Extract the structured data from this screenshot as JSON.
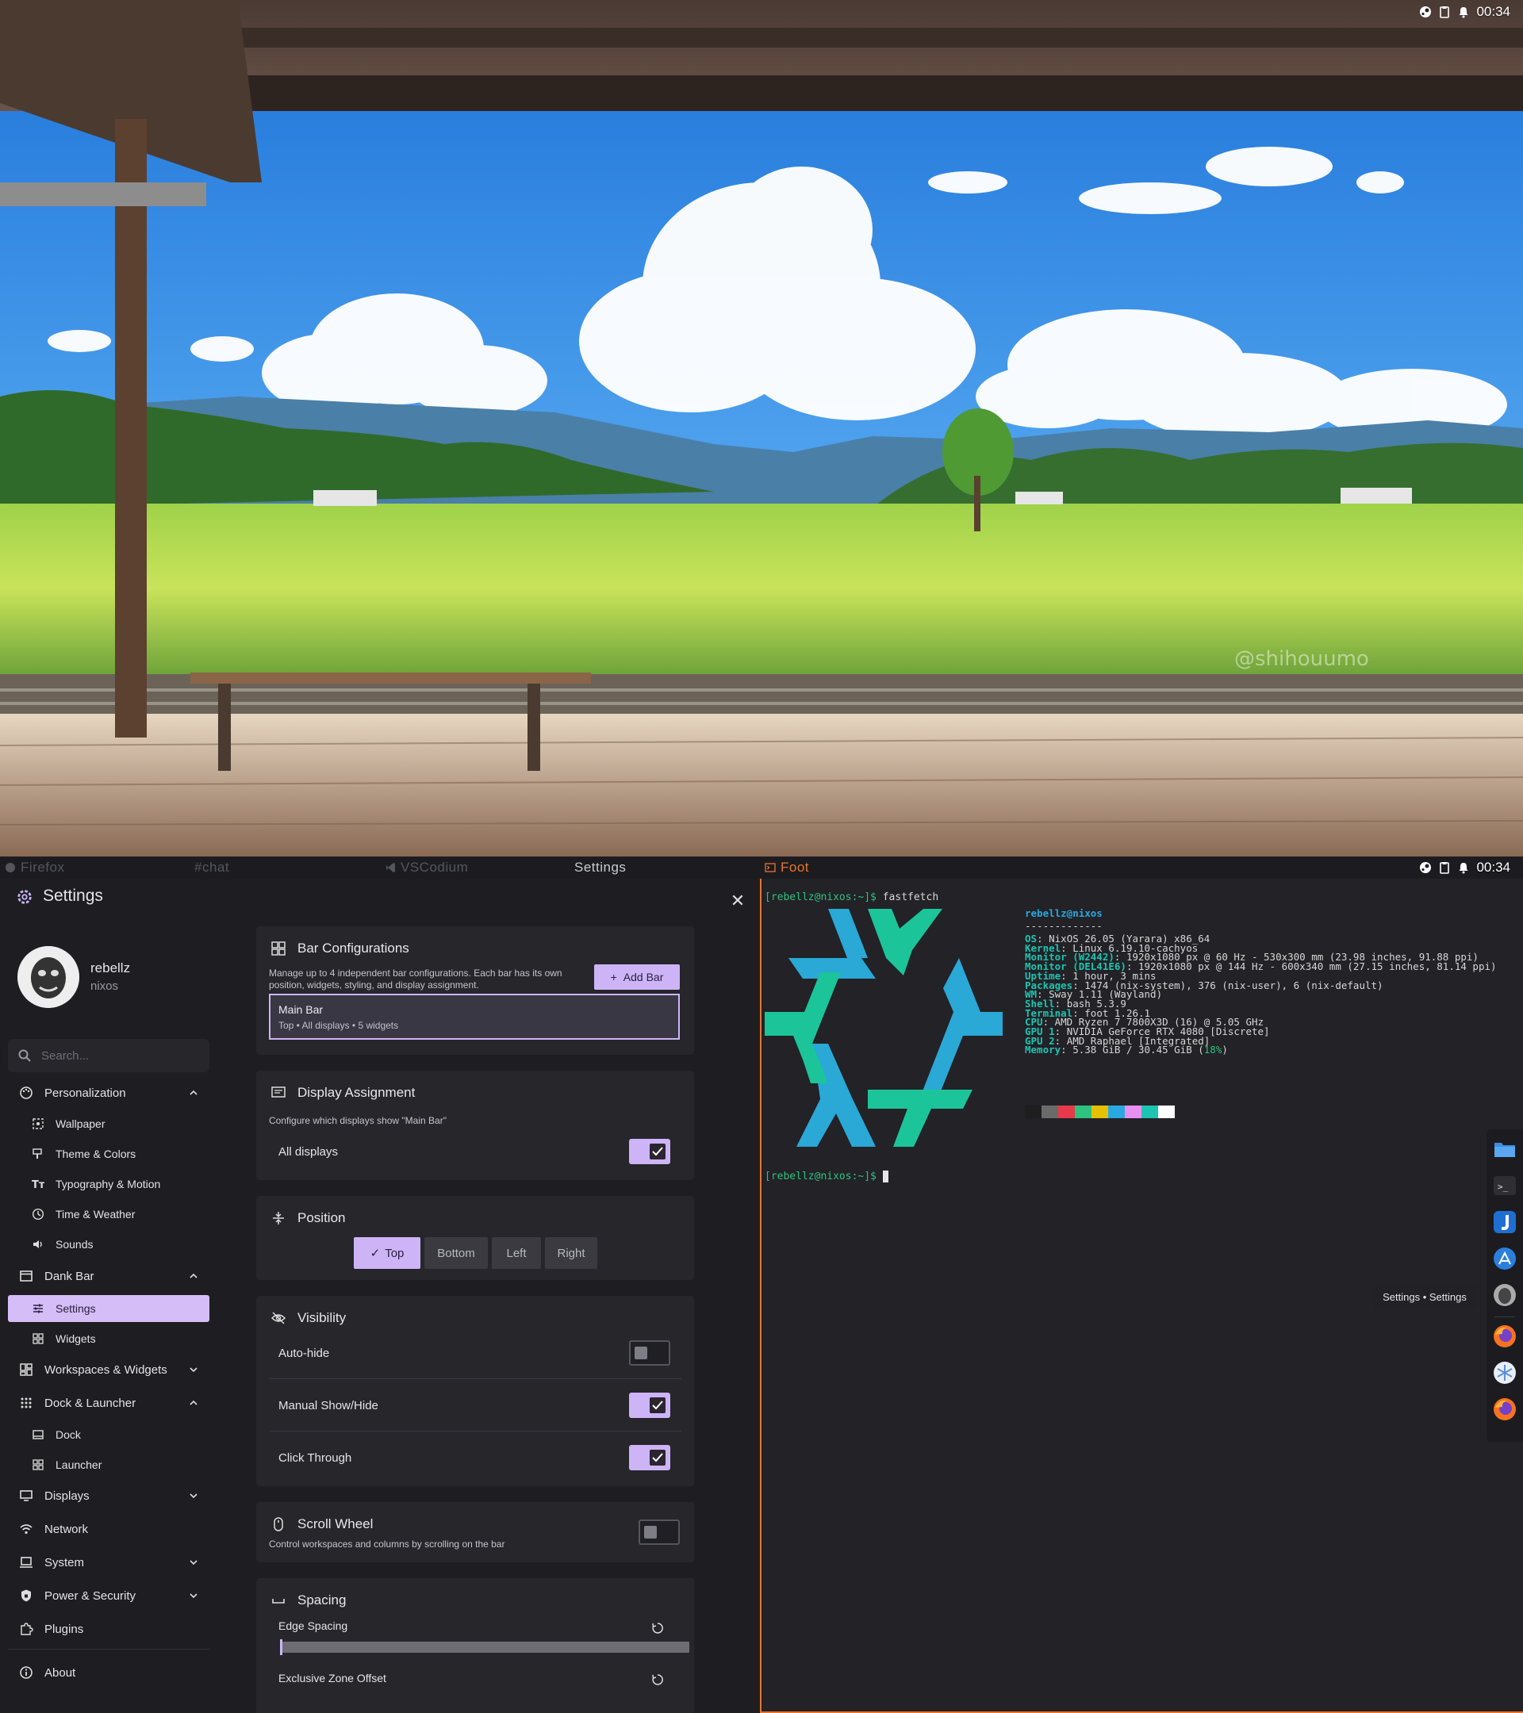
{
  "top_screen": {
    "watermark": "@shihouumo",
    "tray": {
      "time": "00:34",
      "icons": [
        "steam-icon",
        "clipboard-icon",
        "bell-icon"
      ]
    }
  },
  "taskbar": {
    "tabs": [
      {
        "label": "Firefox",
        "icon": "firefox-icon"
      },
      {
        "label": "#chat",
        "icon": ""
      },
      {
        "label": "VSCodium",
        "icon": "vscodium-icon"
      },
      {
        "label": "Settings",
        "icon": ""
      },
      {
        "label": "Foot",
        "icon": "terminal-icon"
      }
    ],
    "tray": {
      "time": "00:34"
    }
  },
  "settings": {
    "title": "Settings",
    "profile": {
      "name": "rebellz",
      "host": "nixos"
    },
    "search_placeholder": "Search...",
    "nav": {
      "personalization": "Personalization",
      "wallpaper": "Wallpaper",
      "theme": "Theme & Colors",
      "typography": "Typography & Motion",
      "time_weather": "Time & Weather",
      "sounds": "Sounds",
      "dank_bar": "Dank Bar",
      "settings": "Settings",
      "widgets": "Widgets",
      "workspaces": "Workspaces & Widgets",
      "dock_launcher": "Dock & Launcher",
      "dock": "Dock",
      "launcher": "Launcher",
      "displays": "Displays",
      "network": "Network",
      "system": "System",
      "power": "Power & Security",
      "plugins": "Plugins",
      "about": "About"
    },
    "bar_config": {
      "title": "Bar Configurations",
      "desc": "Manage up to 4 independent bar configurations. Each bar has its own position, widgets, styling, and display assignment.",
      "add_label": "Add Bar",
      "bar_name": "Main Bar",
      "bar_meta": "Top  •  All displays  •  5 widgets"
    },
    "display_assignment": {
      "title": "Display Assignment",
      "desc": "Configure which displays show \"Main Bar\"",
      "all_displays": "All displays",
      "all_displays_on": true
    },
    "position": {
      "title": "Position",
      "options": [
        "Top",
        "Bottom",
        "Left",
        "Right"
      ],
      "selected": "Top"
    },
    "visibility": {
      "title": "Visibility",
      "auto_hide": "Auto-hide",
      "auto_hide_on": false,
      "manual": "Manual Show/Hide",
      "manual_on": true,
      "click_through": "Click Through",
      "click_through_on": true
    },
    "scroll_wheel": {
      "title": "Scroll Wheel",
      "desc": "Control workspaces and columns by scrolling on the bar",
      "on": false
    },
    "spacing": {
      "title": "Spacing",
      "edge_spacing": "Edge Spacing",
      "edge_spacing_level": 0,
      "exclusive_zone": "Exclusive Zone Offset"
    }
  },
  "terminal": {
    "prompt": "[rebellz@nixos:~]$",
    "command": "fastfetch",
    "user_host": "rebellz@nixos",
    "rule": "-------------",
    "info": [
      {
        "k": "OS",
        "v": ": NixOS 26.05 (Yarara) x86_64"
      },
      {
        "k": "Kernel",
        "v": ": Linux 6.19.10-cachyos"
      },
      {
        "k": "Monitor (W2442)",
        "v": ": 1920x1080 px @ 60 Hz - 530x300 mm (23.98 inches, 91.88 ppi)"
      },
      {
        "k": "Monitor (DEL41E6)",
        "v": ": 1920x1080 px @ 144 Hz - 600x340 mm (27.15 inches, 81.14 ppi)"
      },
      {
        "k": "Uptime",
        "v": ": 1 hour, 3 mins"
      },
      {
        "k": "Packages",
        "v": ": 1474 (nix-system), 376 (nix-user), 6 (nix-default)"
      },
      {
        "k": "WM",
        "v": ": Sway 1.11 (Wayland)"
      },
      {
        "k": "Shell",
        "v": ": bash 5.3.9"
      },
      {
        "k": "Terminal",
        "v": ": foot 1.26.1"
      },
      {
        "k": "CPU",
        "v": ": AMD Ryzen 7 7800X3D (16) @ 5.05 GHz"
      },
      {
        "k": "GPU 1",
        "v": ": NVIDIA GeForce RTX 4080 [Discrete]"
      },
      {
        "k": "GPU 2",
        "v": ": AMD Raphael [Integrated]"
      },
      {
        "k": "Memory",
        "v": ": 5.38 GiB / 30.45 GiB ("
      }
    ],
    "memory_pct": "18%",
    "swatch_colors": [
      "#1e1e1e",
      "#6b6b6b",
      "#e63a4a",
      "#2ec27e",
      "#e5c100",
      "#2aa8e0",
      "#e98ff0",
      "#1cc4b1",
      "#ffffff"
    ]
  },
  "dock": {
    "items": [
      "files-icon",
      "terminal-icon",
      "joplin-icon",
      "appstore-icon",
      "settings-avatar-icon",
      "firefox-icon",
      "snowflake-icon",
      "firefox-icon"
    ],
    "tooltip": "Settings • Settings"
  },
  "colors": {
    "accent": "#cdb4f6",
    "terminal_border": "#e8742c",
    "nix_light": "#2aa8d6",
    "nix_green": "#1cc49a"
  }
}
